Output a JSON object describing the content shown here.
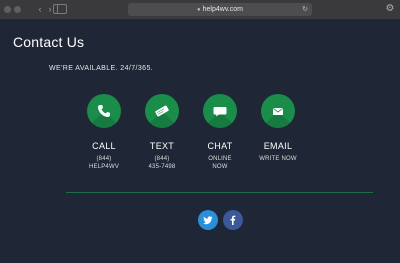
{
  "browser": {
    "url": "help4wv.com"
  },
  "page": {
    "title": "Contact Us",
    "availability": "WE'RE AVAILABLE. 24/7/365."
  },
  "contacts": [
    {
      "label": "CALL",
      "detail_line1": "(844)",
      "detail_line2": "HELP4WV",
      "icon": "phone-icon"
    },
    {
      "label": "TEXT",
      "detail_line1": "(844)",
      "detail_line2": "435-7498",
      "icon": "message-icon"
    },
    {
      "label": "CHAT",
      "detail_line1": "ONLINE",
      "detail_line2": "NOW",
      "icon": "chat-bubble-icon"
    },
    {
      "label": "EMAIL",
      "detail_line1": "WRITE NOW",
      "detail_line2": "",
      "icon": "envelope-icon"
    }
  ],
  "social": [
    {
      "name": "twitter",
      "icon": "twitter-icon",
      "color": "#2a8fd8"
    },
    {
      "name": "facebook",
      "icon": "facebook-icon",
      "color": "#3b5998"
    }
  ],
  "colors": {
    "background": "#1f2635",
    "accent": "#1a8d4a",
    "divider": "#1d6e45"
  }
}
